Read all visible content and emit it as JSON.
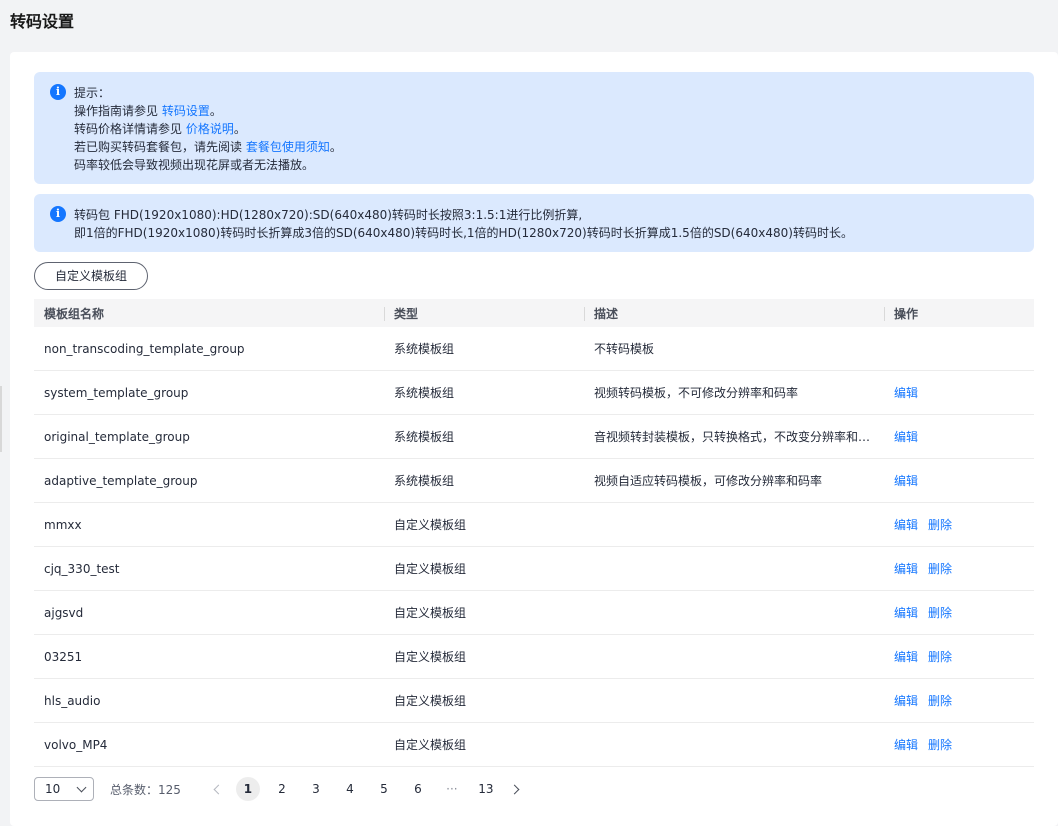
{
  "page": {
    "title": "转码设置"
  },
  "notice1": {
    "title": "提示：",
    "line1_prefix": "操作指南请参见 ",
    "line1_link": "转码设置",
    "line1_suffix": "。",
    "line2_prefix": "转码价格详情请参见 ",
    "line2_link": "价格说明",
    "line2_suffix": "。",
    "line3_prefix": "若已购买转码套餐包，请先阅读 ",
    "line3_link": "套餐包使用须知",
    "line3_suffix": "。",
    "line4": "码率较低会导致视频出现花屏或者无法播放。"
  },
  "notice2": {
    "line1": "转码包 FHD(1920x1080):HD(1280x720):SD(640x480)转码时长按照3:1.5:1进行比例折算,",
    "line2": "即1倍的FHD(1920x1080)转码时长折算成3倍的SD(640x480)转码时长,1倍的HD(1280x720)转码时长折算成1.5倍的SD(640x480)转码时长。"
  },
  "toolbar": {
    "custom_button": "自定义模板组"
  },
  "table": {
    "headers": {
      "name": "模板组名称",
      "type": "类型",
      "desc": "描述",
      "ops": "操作"
    },
    "edit_label": "编辑",
    "delete_label": "删除",
    "rows": [
      {
        "name": "non_transcoding_template_group",
        "type": "系统模板组",
        "desc": "不转码模板"
      },
      {
        "name": "system_template_group",
        "type": "系统模板组",
        "desc": "视频转码模板，不可修改分辨率和码率"
      },
      {
        "name": "original_template_group",
        "type": "系统模板组",
        "desc": "音视频转封装模板，只转换格式，不改变分辨率和码率"
      },
      {
        "name": "adaptive_template_group",
        "type": "系统模板组",
        "desc": "视频自适应转码模板，可修改分辨率和码率"
      },
      {
        "name": "mmxx",
        "type": "自定义模板组",
        "desc": ""
      },
      {
        "name": "cjq_330_test",
        "type": "自定义模板组",
        "desc": ""
      },
      {
        "name": "ajgsvd",
        "type": "自定义模板组",
        "desc": ""
      },
      {
        "name": "03251",
        "type": "自定义模板组",
        "desc": ""
      },
      {
        "name": "hls_audio",
        "type": "自定义模板组",
        "desc": ""
      },
      {
        "name": "volvo_MP4",
        "type": "自定义模板组",
        "desc": ""
      }
    ]
  },
  "pagination": {
    "page_size": "10",
    "total_label": "总条数：125",
    "pages": [
      "1",
      "2",
      "3",
      "4",
      "5",
      "6",
      "···",
      "13"
    ],
    "current": "1"
  },
  "colors": {
    "accent": "#1476ff",
    "notice_bg": "#dbe9fe"
  }
}
